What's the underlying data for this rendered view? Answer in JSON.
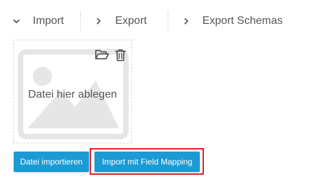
{
  "tabs": [
    {
      "label": "Import",
      "icon": "chevron-down-icon",
      "active": true
    },
    {
      "label": "Export",
      "icon": "chevron-right-icon"
    },
    {
      "label": "Export Schemas",
      "icon": "chevron-right-icon"
    }
  ],
  "dropzone": {
    "label": "Datei hier ablegen",
    "icons": [
      "folder-open-icon",
      "trash-icon",
      "image-placeholder-icon"
    ]
  },
  "buttons": {
    "import_file": "Datei importieren",
    "import_mapping": "Import mit Field Mapping"
  },
  "colors": {
    "accent": "#1b9ad4",
    "highlight": "#e01b1b",
    "placeholder": "#e6e6e6"
  }
}
